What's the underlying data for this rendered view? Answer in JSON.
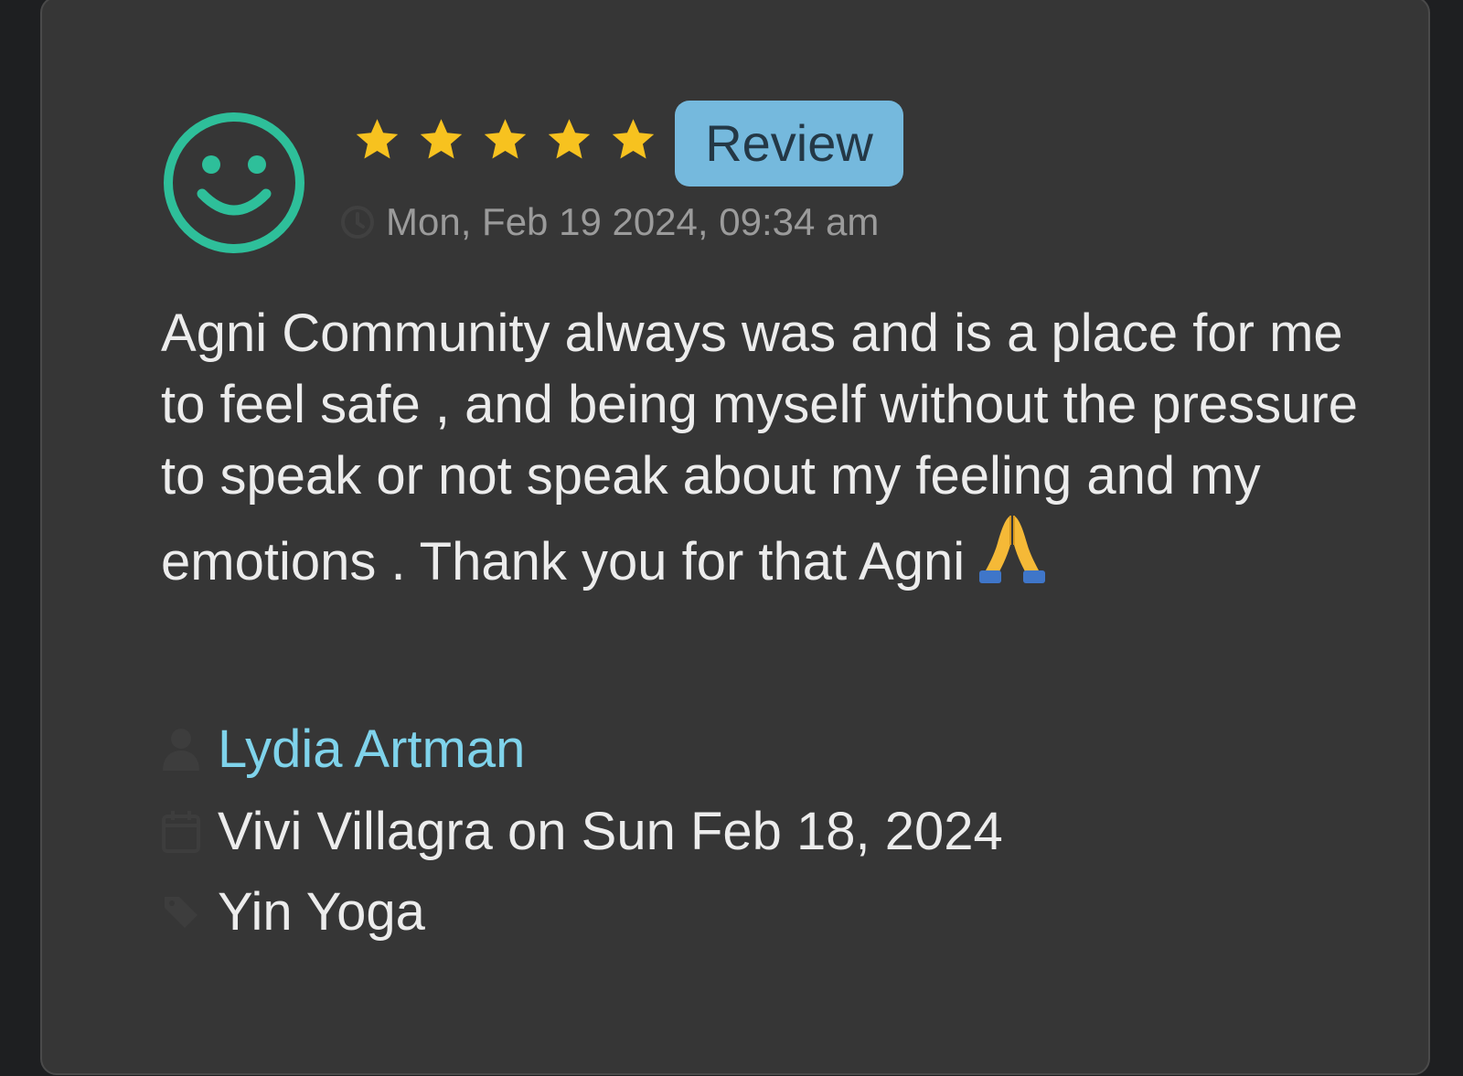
{
  "review": {
    "rating": 5,
    "rating_max": 5,
    "badge_label": "Review",
    "timestamp": "Mon, Feb 19 2024, 09:34 am",
    "text": "Agni Community always was and is a place for me to feel safe , and being myself without the pressure to speak or not speak about my feeling and my emotions . Thank you for that Agni",
    "emoji": "🙏",
    "author": "Lydia Artman",
    "session": "Vivi Villagra on Sun Feb 18, 2024",
    "class_name": "Yin Yoga"
  },
  "colors": {
    "card_background": "#363636",
    "avatar_green": "#2ebf9a",
    "star_yellow": "#f7c21f",
    "badge_blue": "#75b9dd",
    "author_link": "#7fd3eb",
    "muted_text": "#9b9b9b"
  },
  "icons": {
    "avatar": "smiley-face-icon",
    "rating": "star-icon",
    "timestamp": "clock-icon",
    "author": "user-icon",
    "session": "calendar-icon",
    "class": "tag-icon"
  }
}
